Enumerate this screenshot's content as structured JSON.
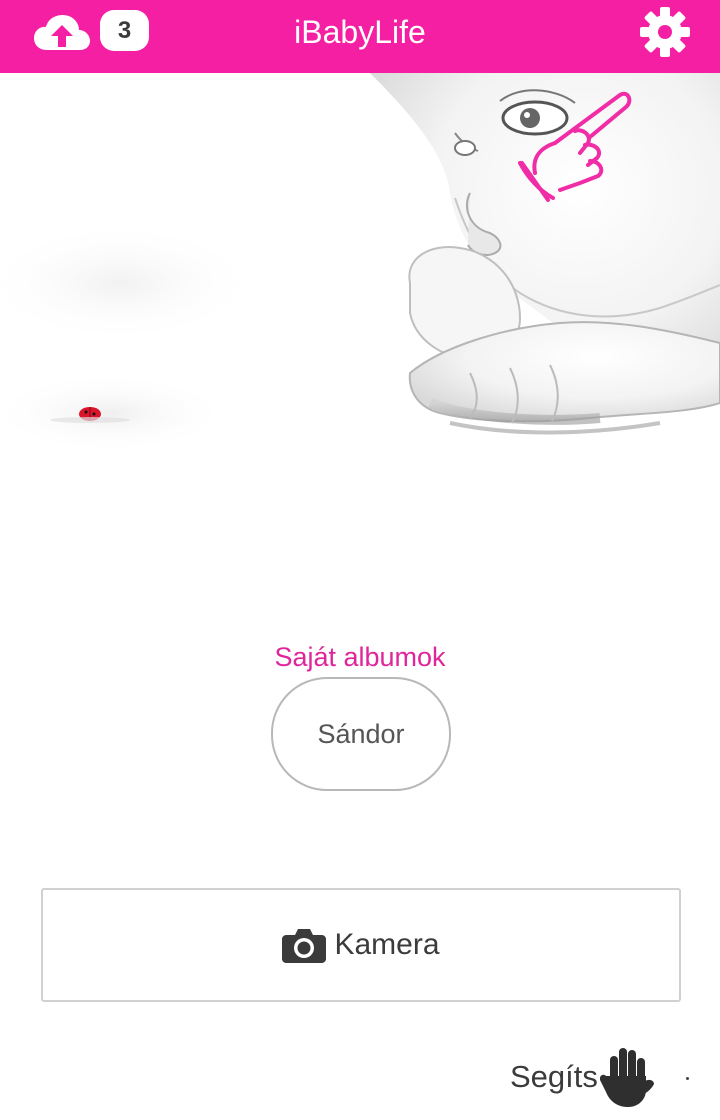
{
  "header": {
    "title": "iBabyLife",
    "upload_icon": "cloud-upload-icon",
    "upload_count": "3",
    "settings_icon": "gear-icon",
    "background_color": "#f51fa3"
  },
  "hero": {
    "image": "baby-sketch-image",
    "overlay_icon": "pointing-hand-icon",
    "accent_icon": "ladybug-icon"
  },
  "albums": {
    "title": "Saját albumok",
    "items": [
      {
        "label": "Sándor"
      }
    ],
    "title_color": "#e0259a"
  },
  "camera": {
    "icon": "camera-icon",
    "label": "Kamera"
  },
  "help": {
    "label": "Segíts",
    "icon": "hand-icon"
  }
}
